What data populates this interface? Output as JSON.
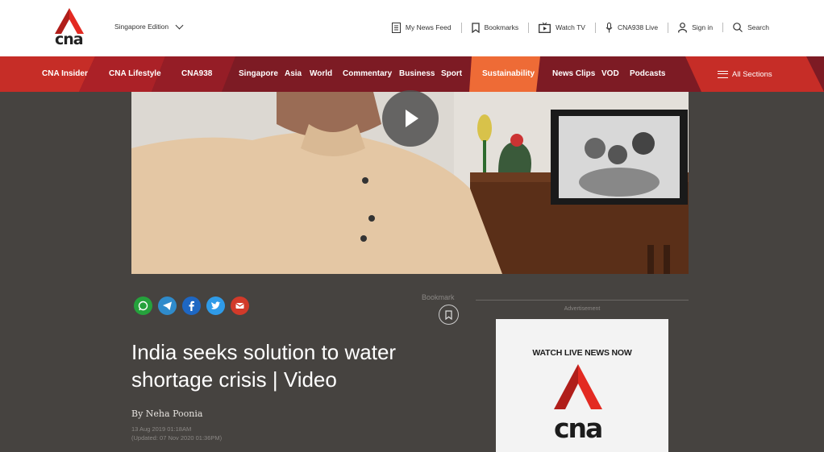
{
  "brand": {
    "logo_text": "cna",
    "accent": "#e32a22",
    "nav_bg": "#7d1b24"
  },
  "header": {
    "edition": "Singapore Edition",
    "links": {
      "news_feed": "My News Feed",
      "bookmarks": "Bookmarks",
      "watch_tv": "Watch TV",
      "live": "CNA938 Live",
      "signin": "Sign in",
      "search": "Search"
    }
  },
  "nav": {
    "items": [
      "CNA Insider",
      "CNA Lifestyle",
      "CNA938",
      "Singapore",
      "Asia",
      "World",
      "Commentary",
      "Business",
      "Sport",
      "Sustainability",
      "News Clips",
      "VOD",
      "Podcasts"
    ],
    "active": "Sustainability",
    "all_sections": "All Sections"
  },
  "share": {
    "icons": [
      "whatsapp-icon",
      "telegram-icon",
      "facebook-icon",
      "twitter-icon",
      "email-icon"
    ],
    "colors": [
      "#25a23c",
      "#2f8bcb",
      "#1e67c3",
      "#2f9be8",
      "#d23a2a"
    ]
  },
  "article": {
    "bookmark_label": "Bookmark",
    "title_line1": "India seeks solution to water",
    "title_line2": "shortage crisis | Video",
    "author": "By Neha Poonia",
    "published": "13 Aug 2019 01:18AM",
    "updated": "(Updated: 07 Nov 2020 01:36PM)"
  },
  "sidebar": {
    "ad_label": "Advertisement",
    "ad_title": "WATCH LIVE NEWS NOW",
    "ad_logo_text": "cna"
  }
}
